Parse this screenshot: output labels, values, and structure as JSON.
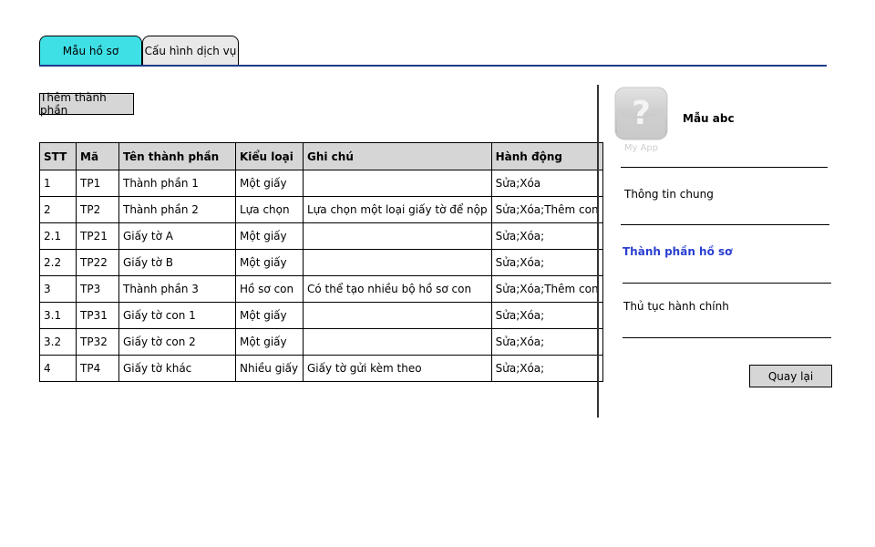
{
  "tabs": [
    {
      "label": "Mẫu hồ sơ"
    },
    {
      "label": "Cấu hình dịch vụ"
    }
  ],
  "toolbar": {
    "add_label": "Thêm thành phần"
  },
  "table": {
    "headers": [
      "STT",
      "Mã",
      "Tên thành phần",
      "Kiểu loại",
      "Ghi chú",
      "Hành động"
    ],
    "rows": [
      [
        "1",
        "TP1",
        "Thành phần 1",
        "Một giấy",
        "",
        "Sửa;Xóa"
      ],
      [
        "2",
        "TP2",
        "Thành phần 2",
        "Lựa chọn",
        "Lựa chọn một loại giấy tờ để nộp",
        "Sửa;Xóa;Thêm con"
      ],
      [
        "2.1",
        "TP21",
        "Giấy tờ A",
        "Một giấy",
        "",
        "Sửa;Xóa;"
      ],
      [
        "2.2",
        "TP22",
        "Giấy tờ B",
        "Một giấy",
        "",
        "Sửa;Xóa;"
      ],
      [
        "3",
        "TP3",
        "Thành phần 3",
        "Hồ sơ con",
        "Có thể tạo nhiều bộ hồ sơ con",
        "Sửa;Xóa;Thêm con"
      ],
      [
        "3.1",
        "TP31",
        "Giấy tờ con 1",
        "Một giấy",
        "",
        "Sửa;Xóa;"
      ],
      [
        "3.2",
        "TP32",
        "Giấy tờ con 2",
        "Một giấy",
        "",
        "Sửa;Xóa;"
      ],
      [
        "4",
        "TP4",
        "Giấy tờ khác",
        "Nhiều giấy",
        "Giấy tờ gửi kèm theo",
        "Sửa;Xóa;"
      ]
    ]
  },
  "panel": {
    "app_icon_caption": "My App",
    "app_icon": "question-mark-icon",
    "title": "Mẫu abc",
    "items": [
      {
        "label": "Thông tin chung"
      },
      {
        "label": "Thành phần hồ sơ"
      },
      {
        "label": "Thủ tục hành chính"
      }
    ],
    "back_label": "Quay lại"
  },
  "colors": {
    "active_tab": "#3ee0e6",
    "tab_underline": "#1e3a8a",
    "active_link": "#2a3fd0",
    "button_bg": "#d6d6d6"
  }
}
